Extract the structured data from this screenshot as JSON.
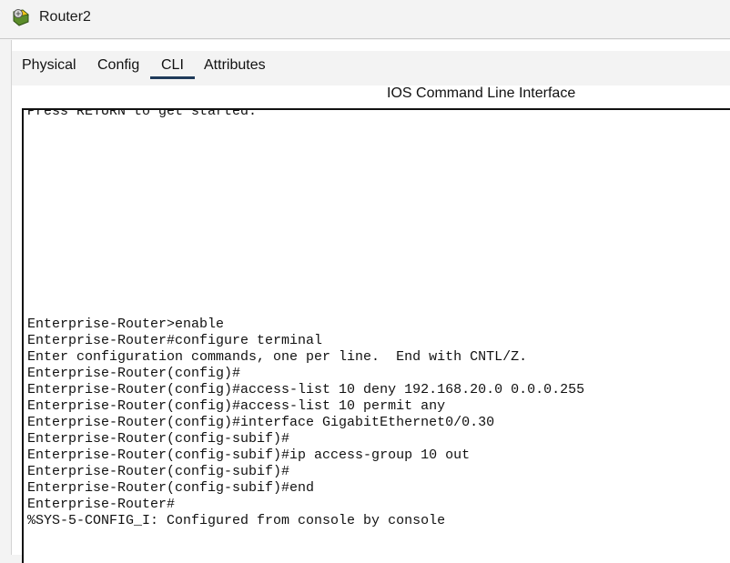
{
  "window": {
    "title": "Router2",
    "icon": "router-icon"
  },
  "tabs": [
    {
      "label": "Physical",
      "active": false
    },
    {
      "label": "Config",
      "active": false
    },
    {
      "label": "CLI",
      "active": true
    },
    {
      "label": "Attributes",
      "active": false
    }
  ],
  "panel": {
    "header": "IOS Command Line Interface"
  },
  "terminal": {
    "top_line": "Press RETURN to get started.",
    "lines": [
      "Enterprise-Router>enable",
      "Enterprise-Router#configure terminal",
      "Enter configuration commands, one per line.  End with CNTL/Z.",
      "Enterprise-Router(config)#",
      "Enterprise-Router(config)#access-list 10 deny 192.168.20.0 0.0.0.255",
      "Enterprise-Router(config)#access-list 10 permit any",
      "Enterprise-Router(config)#interface GigabitEthernet0/0.30",
      "Enterprise-Router(config-subif)#",
      "Enterprise-Router(config-subif)#ip access-group 10 out",
      "Enterprise-Router(config-subif)#",
      "Enterprise-Router(config-subif)#end",
      "Enterprise-Router#",
      "%SYS-5-CONFIG_I: Configured from console by console"
    ]
  },
  "colors": {
    "tab_underline": "#1f3a5a",
    "terminal_border": "#111111",
    "background": "#f3f3f3"
  }
}
